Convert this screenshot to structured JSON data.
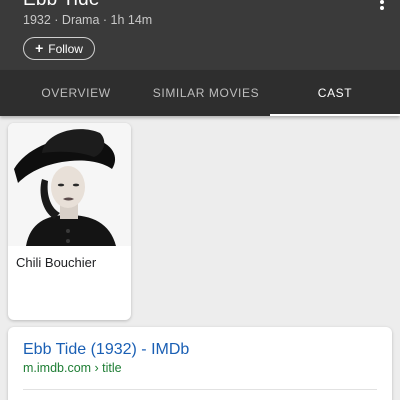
{
  "header": {
    "title": "Ebb Tide",
    "meta": "1932 · Drama · 1h 14m",
    "follow_label": "Follow",
    "more_icon": "more-vert-icon"
  },
  "tabs": [
    {
      "label": "OVERVIEW",
      "active": false
    },
    {
      "label": "SIMILAR MOVIES",
      "active": false
    },
    {
      "label": "CAST",
      "active": true
    }
  ],
  "cast": [
    {
      "name": "Chili Bouchier"
    }
  ],
  "result": {
    "title": "Ebb Tide (1932) - IMDb",
    "url": "m.imdb.com › title"
  },
  "colors": {
    "header_bg": "#3a3a3a",
    "tabs_bg": "#2e2e2e",
    "link_blue": "#1a5fb4",
    "url_green": "#1e7e34"
  }
}
